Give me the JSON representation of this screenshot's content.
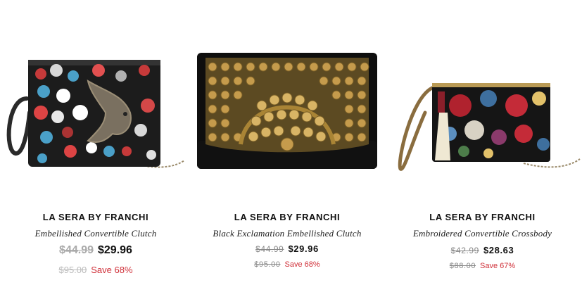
{
  "products": [
    {
      "brand": "LA SERA BY FRANCHI",
      "name": "Embellished Convertible Clutch",
      "was_price": "$44.99",
      "price": "$29.96",
      "original_price": "$95.00",
      "save": "Save 68%"
    },
    {
      "brand": "LA SERA BY FRANCHI",
      "name": "Black Exclamation Embellished Clutch",
      "was_price": "$44.99",
      "price": "$29.96",
      "original_price": "$95.00",
      "save": "Save 68%"
    },
    {
      "brand": "LA SERA BY FRANCHI",
      "name": "Embroidered Convertible Crossbody",
      "was_price": "$42.99",
      "price": "$28.63",
      "original_price": "$88.00",
      "save": "Save 67%"
    }
  ],
  "colors": {
    "sale_red": "#d0313a",
    "strike_gray": "#aaaaaa",
    "text": "#111111"
  }
}
